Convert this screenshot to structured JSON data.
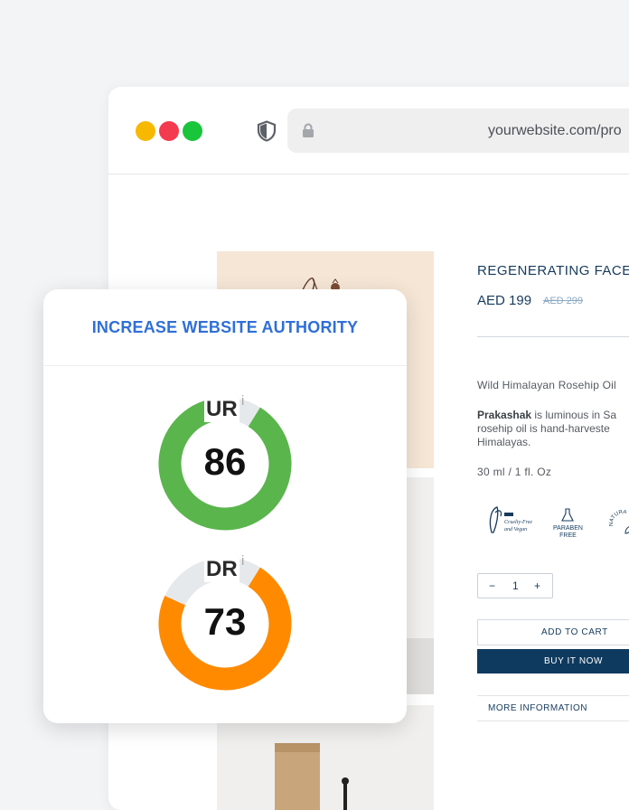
{
  "browser": {
    "url": "yourwebsite.com/pro"
  },
  "product": {
    "title": "REGENERATING FACE",
    "price": "AED 199",
    "old_price": "AED 299",
    "subtitle": "Wild Himalayan Rosehip Oil",
    "desc_brand": "Prakashak",
    "desc_line1": " is luminous in Sa",
    "desc_line2": "rosehip oil is hand-harveste",
    "desc_line3": "Himalayas.",
    "size": "30 ml / 1 fl. Oz",
    "badge_cruelty": "Cruelty-Free and Vegan",
    "badge_paraben_1": "PARABEN",
    "badge_paraben_2": "FREE",
    "badge_natural": "NATURAL",
    "qty_minus": "−",
    "qty_value": "1",
    "qty_plus": "+",
    "add_to_cart": "ADD TO CART",
    "buy_now": "BUY IT NOW",
    "more_info": "MORE INFORMATION"
  },
  "authority_card": {
    "title": "INCREASE WEBSITE AUTHORITY",
    "ur_label": "UR",
    "ur_info": "i",
    "ur_value": "86",
    "dr_label": "DR",
    "dr_info": "i",
    "dr_value": "73",
    "ur_color": "#5ab54c",
    "dr_color": "#ff8a00",
    "track_color": "#e6e9ec"
  }
}
